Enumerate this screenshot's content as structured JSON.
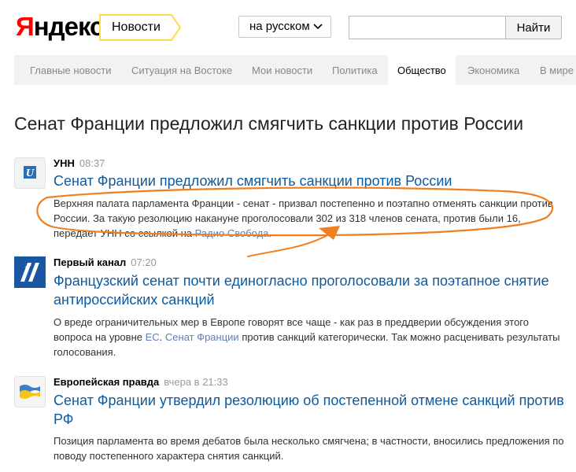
{
  "logo": {
    "first": "Я",
    "rest": "ндекс"
  },
  "service_tab": "Новости",
  "lang_select": "на русском",
  "search": {
    "value": "",
    "button": "Найти"
  },
  "nav": [
    "Главные новости",
    "Ситуация на Востоке",
    "Мои новости",
    "Политика",
    "Общество",
    "Экономика",
    "В мире"
  ],
  "nav_active": "Общество",
  "headline": "Сенат Франции предложил смягчить санкции против России",
  "stories": [
    {
      "icon": "unn-icon",
      "source": "УНН",
      "time": "08:37",
      "title": "Сенат Франции предложил смягчить санкции против России",
      "snippet_1": "Верхняя палата парламента Франции - сенат - призвал постепенно и поэтапно отменять санкции против России. За такую резолюцию накануне проголосовали 302 из 318 членов сената, против были 16, передает УНН со ссылкой на ",
      "snippet_link": "Радио Свобода",
      "snippet_2": "."
    },
    {
      "icon": "perviy-kanal-icon",
      "source": "Первый канал",
      "time": "07:20",
      "title": "Французский сенат почти единогласно проголосовали за поэтапное снятие антироссийских санкций",
      "snippet_1": "О вреде ограничительных мер в Европе говорят все чаще - как раз в преддверии обсуждения этого вопроса на уровне ",
      "snippet_link_1": "ЕС",
      "snippet_2": ". ",
      "snippet_link_2": "Сенат Франции",
      "snippet_3": " против санкций категорически. Так можно расценивать результаты голосования."
    },
    {
      "icon": "evropeiskaya-pravda-icon",
      "source": "Европейская правда",
      "time": "вчера в 21:33",
      "title": "Сенат Франции утвердил резолюцию об постепенной отмене санкций против РФ",
      "snippet": "Позиция парламента во время дебатов была несколько смягчена; в частности, вносились предложения по поводу постепенного характера снятия санкций."
    }
  ],
  "colors": {
    "link": "#0e5a9c",
    "accent": "#ffdb4d",
    "annotation": "#f07f1f"
  }
}
